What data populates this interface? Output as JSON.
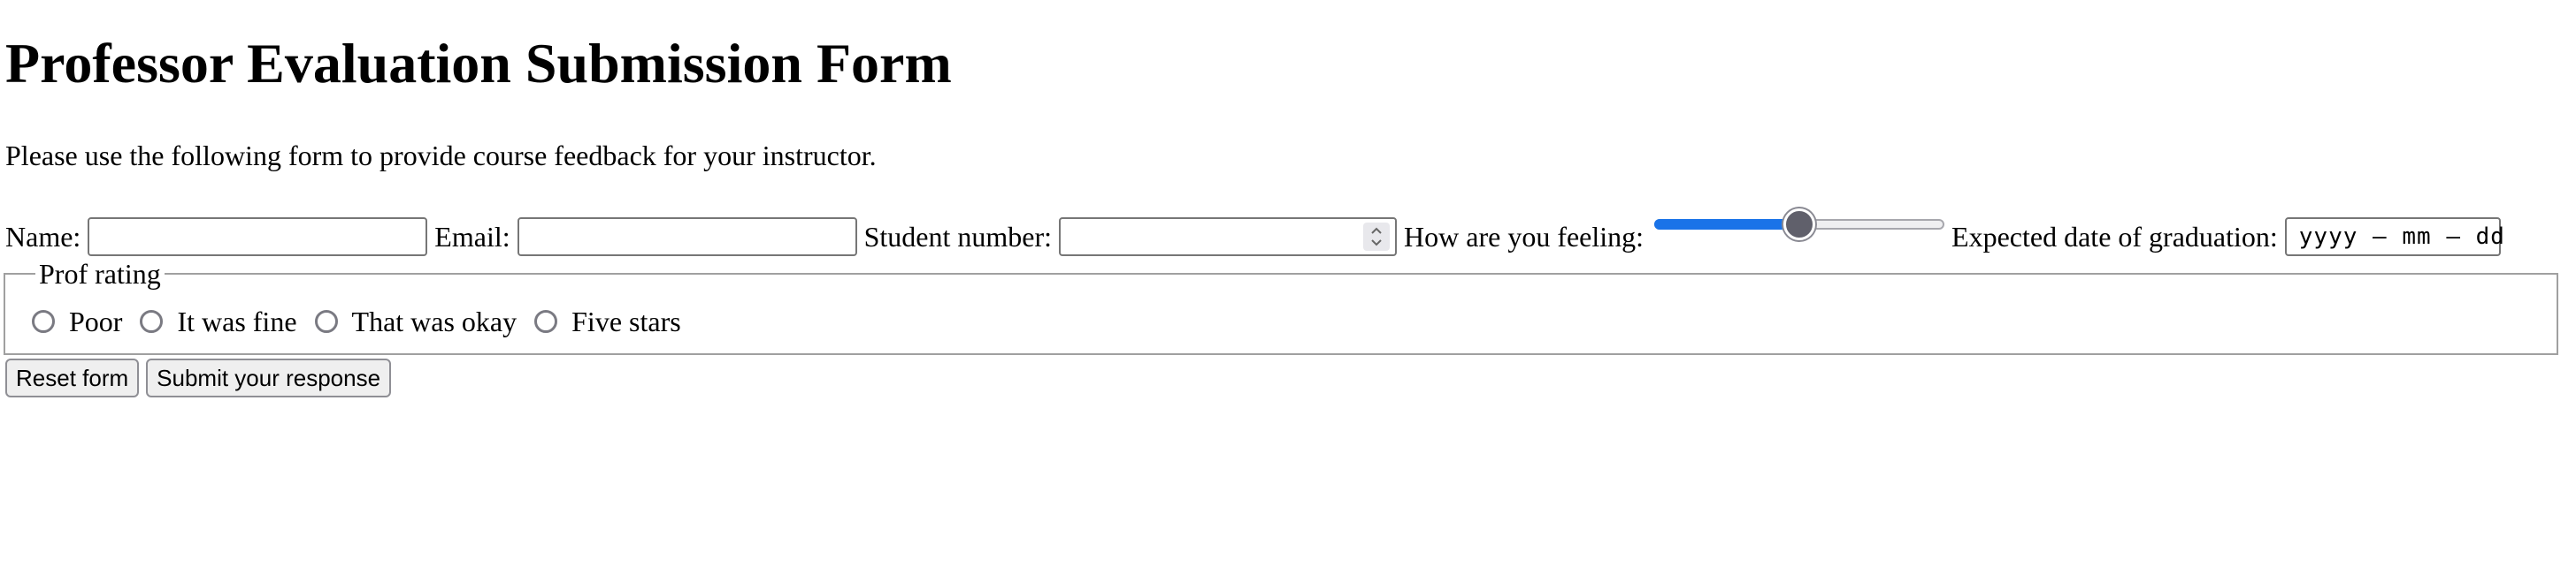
{
  "page": {
    "title": "Professor Evaluation Submission Form",
    "intro": "Please use the following form to provide course feedback for your instructor."
  },
  "fields": {
    "name_label": "Name:",
    "name_value": "",
    "email_label": "Email:",
    "email_value": "",
    "student_number_label": "Student number:",
    "student_number_value": "",
    "feeling_label": "How are you feeling:",
    "feeling_level": 0.5,
    "graduation_label": "Expected date of graduation:",
    "graduation_placeholder": "yyyy – mm – dd"
  },
  "rating": {
    "legend": "Prof rating",
    "options": [
      "Poor",
      "It was fine",
      "That was okay",
      "Five stars"
    ]
  },
  "buttons": {
    "reset_label": "Reset form",
    "submit_label": "Submit your response"
  },
  "colors": {
    "slider_fill": "#1a73e8",
    "slider_thumb": "#60606b"
  },
  "icons": {
    "spinner": "up-down-chevrons-icon"
  }
}
